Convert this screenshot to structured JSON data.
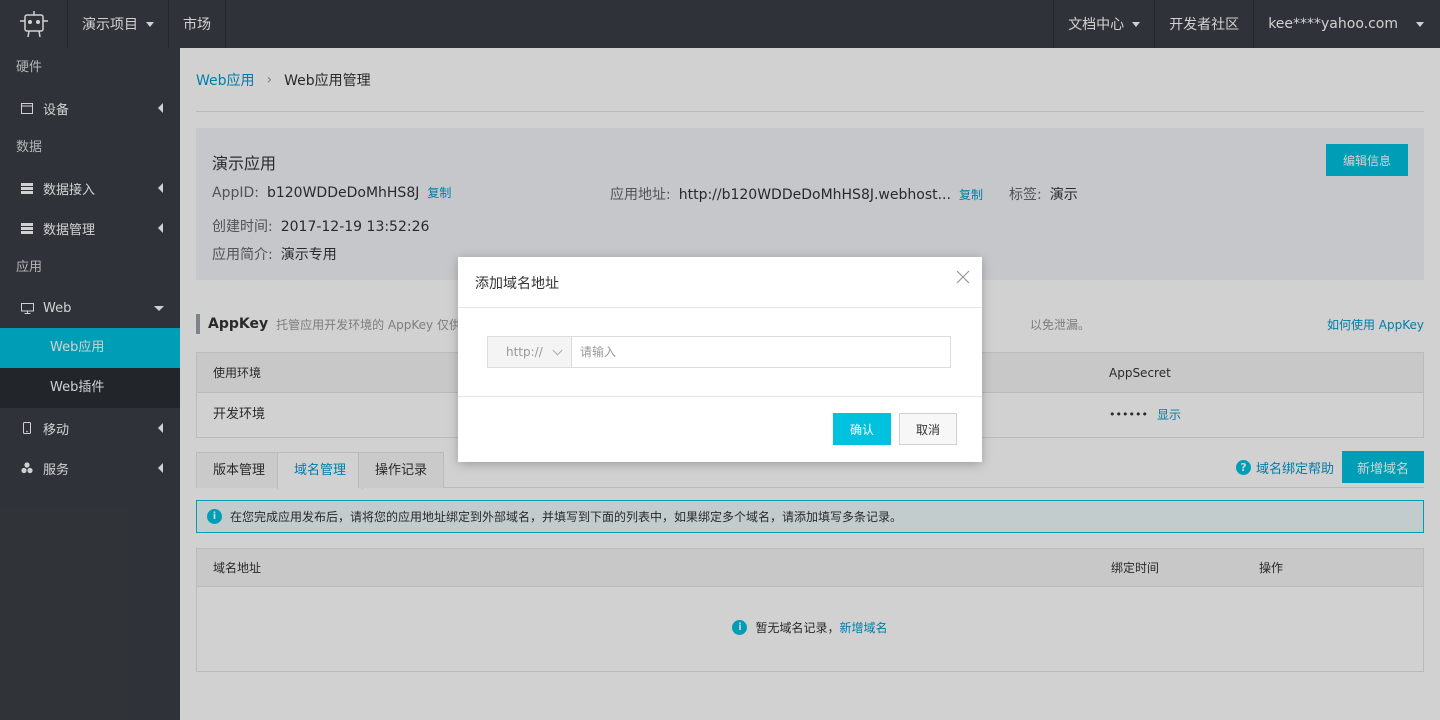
{
  "topbar": {
    "logo_icon": "robot-logo-icon",
    "project": "演示项目",
    "market": "市场",
    "docs": "文档中心",
    "community": "开发者社区",
    "account": "kee****yahoo.com"
  },
  "sidebar": {
    "group_hardware": "硬件",
    "device": "设备",
    "group_data": "数据",
    "data_access": "数据接入",
    "data_manage": "数据管理",
    "group_app": "应用",
    "web": "Web",
    "web_app": "Web应用",
    "web_plugin": "Web插件",
    "mobile": "移动",
    "service": "服务"
  },
  "breadcrumb": {
    "parent": "Web应用",
    "current": "Web应用管理"
  },
  "app": {
    "name": "演示应用",
    "edit_label": "编辑信息",
    "appid_label": "AppID:",
    "appid": "b120WDDeDoMhHS8J",
    "copy": "复制",
    "url_label": "应用地址:",
    "url": "http://b120WDDeDoMhHS8J.webhost...",
    "tag_label": "标签:",
    "tag": "演示",
    "created_label": "创建时间:",
    "created": "2017-12-19 13:52:26",
    "intro_label": "应用简介:",
    "intro": "演示专用"
  },
  "appkey": {
    "title": "AppKey",
    "desc_start": "托管应用开发环境的 AppKey 仅供开",
    "desc_end": "以免泄漏。",
    "help": "如何使用 AppKey",
    "col_env": "使用环境",
    "col_secret": "AppSecret",
    "row_env": "开发环境",
    "row_secret": "••••••",
    "show": "显示"
  },
  "tabs": [
    {
      "label": "版本管理"
    },
    {
      "label": "域名管理"
    },
    {
      "label": "操作记录"
    }
  ],
  "domain": {
    "bind_help": "域名绑定帮助",
    "add_label": "新增域名",
    "notice": "在您完成应用发布后，请将您的应用地址绑定到外部域名，并填写到下面的列表中，如果绑定多个域名，请添加填写多条记录。",
    "col_domain": "域名地址",
    "col_time": "绑定时间",
    "col_action": "操作",
    "empty_text": "暂无域名记录，",
    "empty_link": "新增域名"
  },
  "modal": {
    "title": "添加域名地址",
    "protocol": "http://",
    "placeholder": "请输入",
    "ok": "确认",
    "cancel": "取消"
  },
  "colors": {
    "accent": "#00c1de",
    "link": "#0099cc",
    "dark": "#3a3f46"
  }
}
